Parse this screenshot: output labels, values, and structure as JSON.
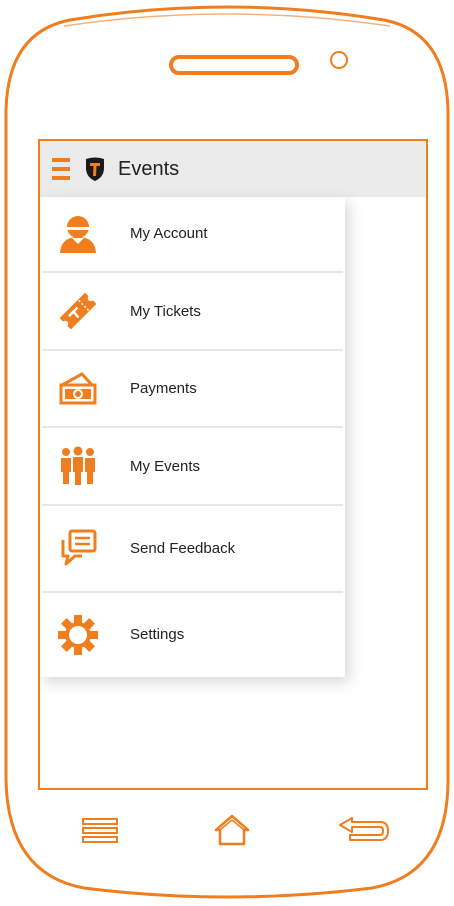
{
  "colors": {
    "accent": "#f07d1e",
    "app_bar_bg": "#ebebeb",
    "divider": "#e7e7e7",
    "text": "#222222"
  },
  "app_bar": {
    "title": "Events",
    "menu_icon": "hamburger-menu-icon",
    "logo_icon": "ticket-shield-logo-icon"
  },
  "drawer": {
    "items": [
      {
        "label": "My Account",
        "icon": "user-icon"
      },
      {
        "label": "My Tickets",
        "icon": "ticket-icon"
      },
      {
        "label": "Payments",
        "icon": "cash-icon"
      },
      {
        "label": "My Events",
        "icon": "group-icon"
      },
      {
        "label": "Send Feedback",
        "icon": "chat-feedback-icon"
      },
      {
        "label": "Settings",
        "icon": "gear-icon"
      }
    ]
  },
  "system_nav": {
    "menu": "menu-icon",
    "home": "home-icon",
    "back": "back-icon"
  }
}
